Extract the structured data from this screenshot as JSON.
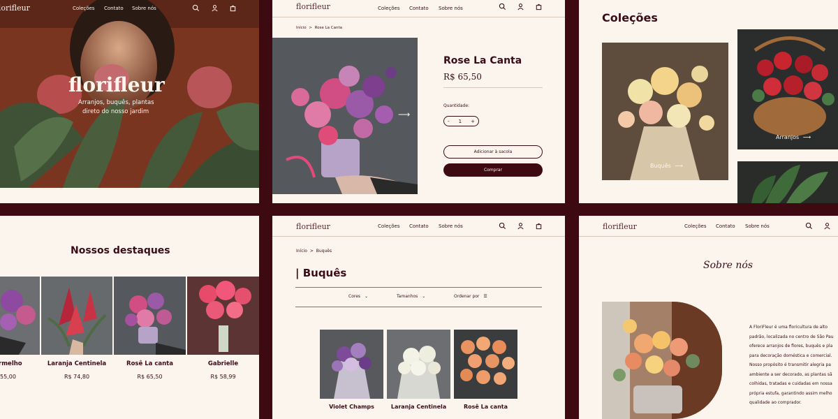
{
  "colors": {
    "background": "#3d0a12",
    "cream": "#fcf5ee",
    "wine": "#3a0d14"
  },
  "nav": {
    "logo": "florifleur",
    "links": [
      "Coleções",
      "Contato",
      "Sobre nós"
    ]
  },
  "hero": {
    "title": "florifleur",
    "subtitle_line1": "Arranjos, buquês, plantas",
    "subtitle_line2": "direto do nosso jardim"
  },
  "product": {
    "breadcrumb_home": "Início",
    "breadcrumb_sep": ">",
    "breadcrumb_current": "Rose La Canta",
    "name": "Rose La Canta",
    "price": "R$ 65,50",
    "quantity_label": "Quantidade:",
    "quantity": "1",
    "minus": "-",
    "plus": "+",
    "add_to_cart": "Adicionar à sacola",
    "buy": "Comprar",
    "arrow": "⟶"
  },
  "collections": {
    "title": "Coleções",
    "cards": [
      {
        "label": "Buquês",
        "arrow": "⟶"
      },
      {
        "label": "Arranjos",
        "arrow": "⟶"
      }
    ]
  },
  "highlights": {
    "title": "Nossos destaques",
    "items": [
      {
        "name": "rmelho",
        "price": "55,00"
      },
      {
        "name": "Laranja Centinela",
        "price": "R$ 74,80"
      },
      {
        "name": "Rosê La canta",
        "price": "R$ 65,50"
      },
      {
        "name": "Gabrielle",
        "price": "R$ 58,99"
      }
    ]
  },
  "bouquets": {
    "breadcrumb_home": "Início",
    "breadcrumb_sep": ">",
    "breadcrumb_current": "Buquês",
    "title": "| Buquês",
    "filters": [
      "Cores",
      "Tamanhos"
    ],
    "sort": "Ordenar por",
    "items": [
      {
        "name": "Violet Champs"
      },
      {
        "name": "Laranja Centinela"
      },
      {
        "name": "Rosê La canta"
      }
    ]
  },
  "about": {
    "title": "Sobre nós",
    "lines": [
      "A FloriFleur é uma floricultura de alto",
      "padrão, localizada no centro de São Pau",
      "oferece arranjos de flores, buquês e pla",
      "para decoração doméstica e comercial.",
      "Nosso propósito é transmitir alegria pa",
      "ambiente a ser decorado, as plantas sã",
      "colhidas, tratadas e cuidadas em nossa",
      "própria estufa, garantindo assim melho",
      "qualidade ao comprador."
    ]
  }
}
